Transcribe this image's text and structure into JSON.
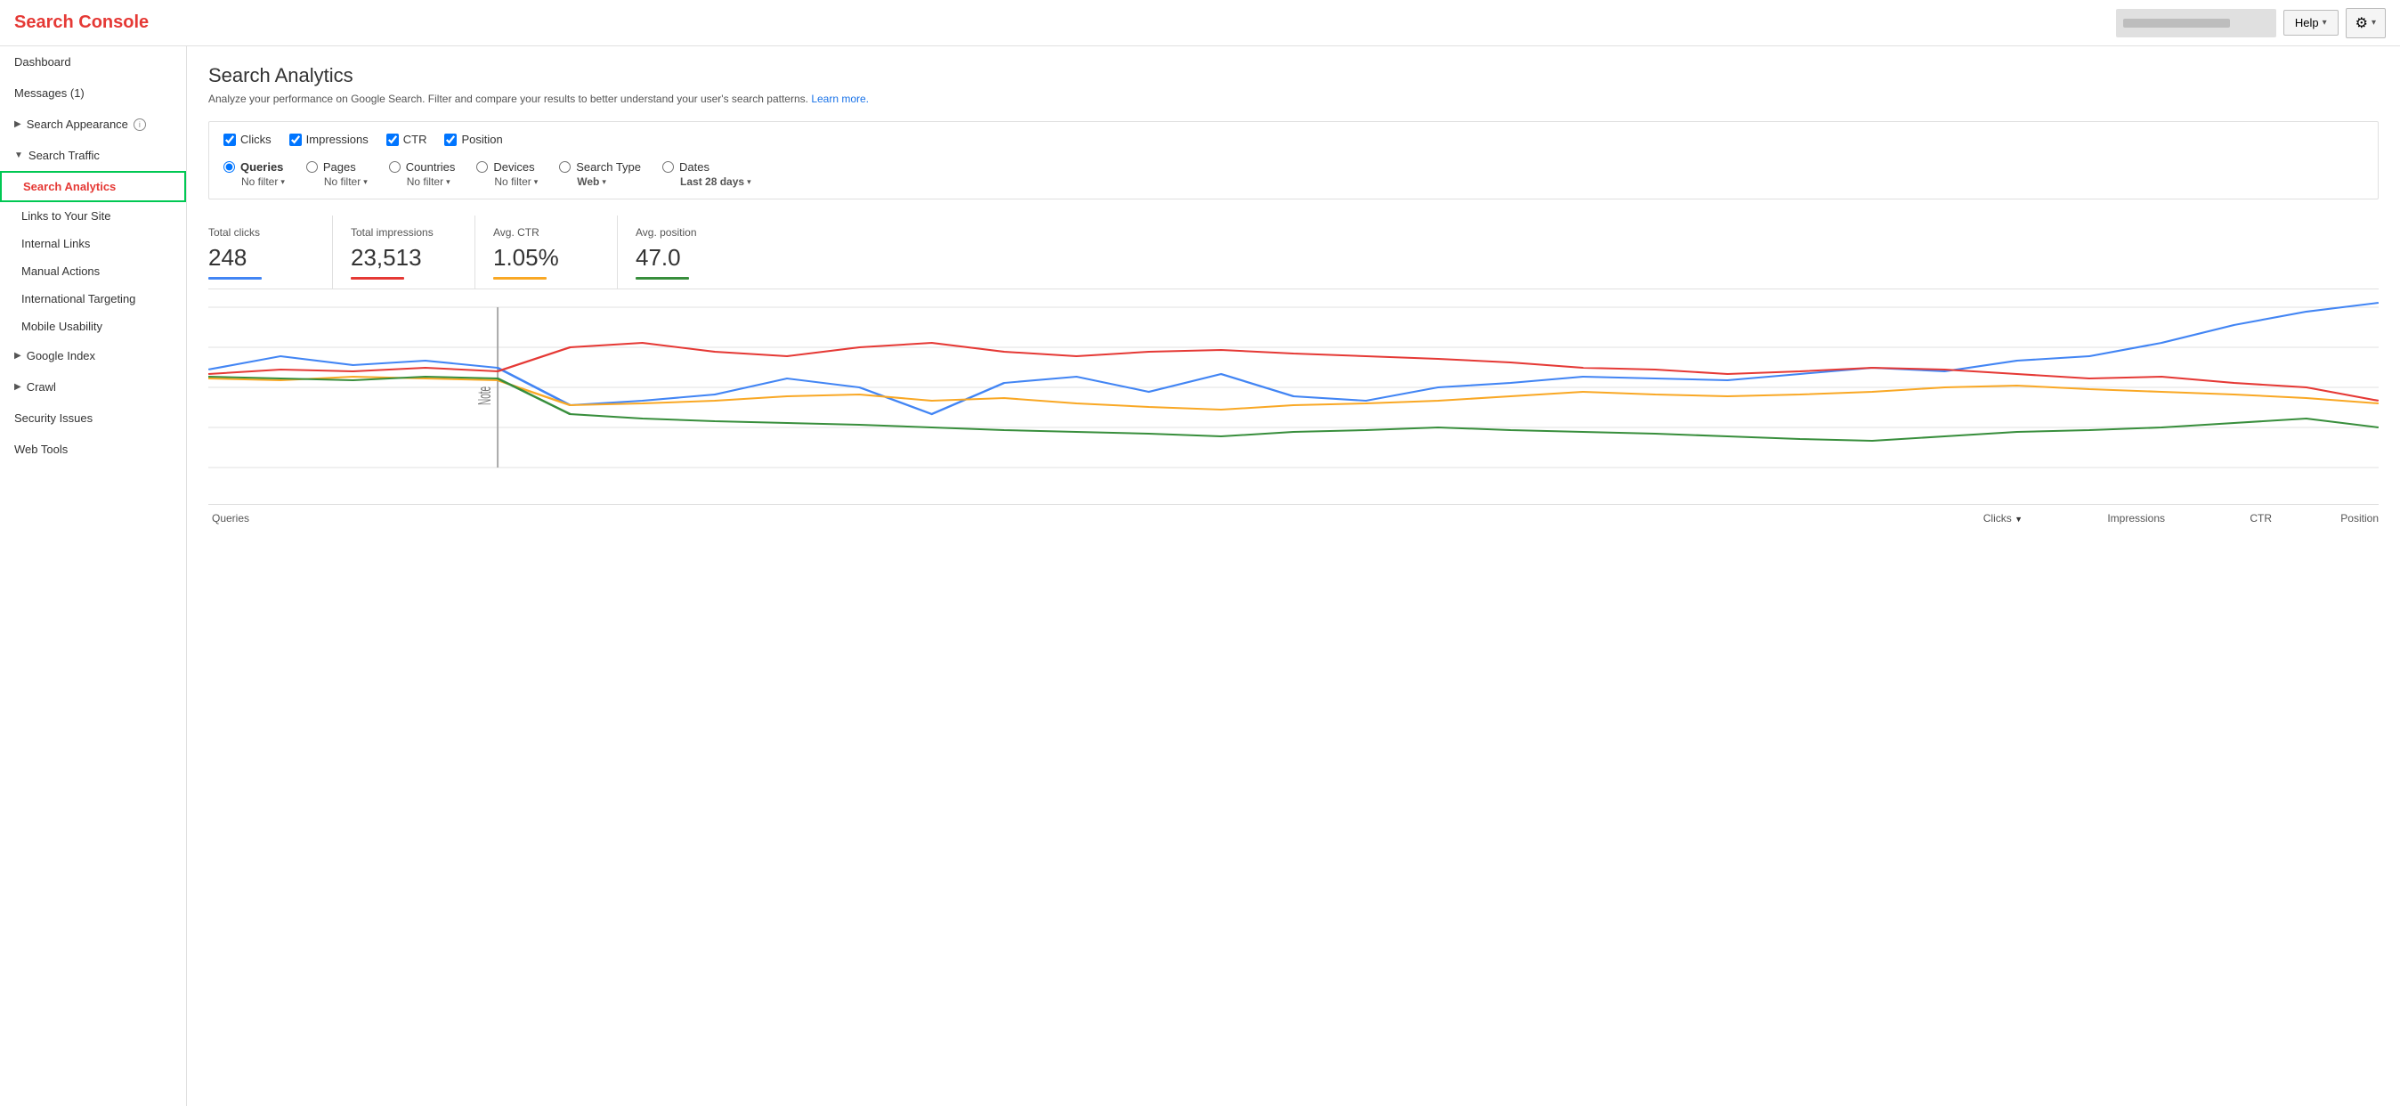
{
  "topbar": {
    "logo": "Search Console",
    "help_label": "Help",
    "gear_icon": "⚙",
    "chevron": "▾"
  },
  "sidebar": {
    "dashboard_label": "Dashboard",
    "messages_label": "Messages (1)",
    "search_appearance_label": "Search Appearance",
    "search_traffic_label": "Search Traffic",
    "search_analytics_label": "Search Analytics",
    "links_to_site_label": "Links to Your Site",
    "internal_links_label": "Internal Links",
    "manual_actions_label": "Manual Actions",
    "international_targeting_label": "International Targeting",
    "mobile_usability_label": "Mobile Usability",
    "google_index_label": "Google Index",
    "crawl_label": "Crawl",
    "security_issues_label": "Security Issues",
    "web_tools_label": "Web Tools"
  },
  "main": {
    "page_title": "Search Analytics",
    "page_subtitle": "Analyze your performance on Google Search. Filter and compare your results to better understand your user's search patterns.",
    "learn_more_label": "Learn more.",
    "filter_checkboxes": [
      {
        "label": "Clicks",
        "checked": true
      },
      {
        "label": "Impressions",
        "checked": true
      },
      {
        "label": "CTR",
        "checked": true
      },
      {
        "label": "Position",
        "checked": true
      }
    ],
    "filter_radios": [
      {
        "label": "Queries",
        "sublabel": "No filter",
        "selected": true
      },
      {
        "label": "Pages",
        "sublabel": "No filter",
        "selected": false
      },
      {
        "label": "Countries",
        "sublabel": "No filter",
        "selected": false
      },
      {
        "label": "Devices",
        "sublabel": "No filter",
        "selected": false
      },
      {
        "label": "Search Type",
        "sublabel": "Web",
        "selected": false
      },
      {
        "label": "Dates",
        "sublabel": "Last 28 days",
        "selected": false
      }
    ],
    "stats": [
      {
        "label": "Total clicks",
        "value": "248",
        "color": "#4285f4"
      },
      {
        "label": "Total impressions",
        "value": "23,513",
        "color": "#e53935"
      },
      {
        "label": "Avg. CTR",
        "value": "1.05%",
        "color": "#f9a825"
      },
      {
        "label": "Avg. position",
        "value": "47.0",
        "color": "#388e3c"
      }
    ],
    "chart_note": "Note",
    "table_columns": [
      {
        "label": "Queries",
        "sortable": false
      },
      {
        "label": "Clicks",
        "sortable": true,
        "sort_dir": "▼"
      },
      {
        "label": "Impressions",
        "sortable": false
      },
      {
        "label": "CTR",
        "sortable": false
      },
      {
        "label": "Position",
        "sortable": false
      }
    ]
  }
}
